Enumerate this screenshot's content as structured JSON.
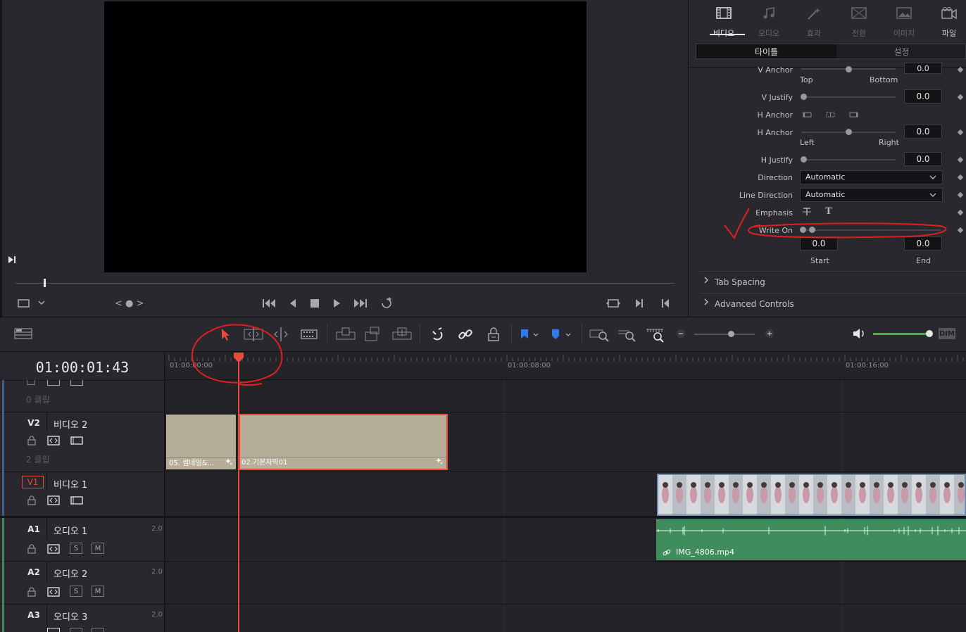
{
  "viewer": {
    "nav_label": "< ● >"
  },
  "inspector": {
    "tabs": [
      {
        "label": "비디오",
        "icon": "film-icon",
        "active": true
      },
      {
        "label": "오디오",
        "icon": "music-note-icon",
        "active": false
      },
      {
        "label": "효과",
        "icon": "magic-wand-icon",
        "active": false
      },
      {
        "label": "전환",
        "icon": "transition-icon",
        "active": false
      },
      {
        "label": "이미지",
        "icon": "image-icon",
        "active": false
      },
      {
        "label": "파일",
        "icon": "file-icon",
        "active": false
      }
    ],
    "subtabs": {
      "title": "타이틀",
      "settings": "설정"
    },
    "v_anchor": {
      "label": "V Anchor",
      "value": "0.0",
      "min_label": "Top",
      "max_label": "Bottom"
    },
    "v_justify": {
      "label": "V Justify",
      "value": "0.0"
    },
    "h_anchor_icons_label": "H Anchor",
    "h_anchor": {
      "label": "H Anchor",
      "value": "0.0",
      "min_label": "Left",
      "max_label": "Right"
    },
    "h_justify": {
      "label": "H Justify",
      "value": "0.0"
    },
    "direction": {
      "label": "Direction",
      "value": "Automatic"
    },
    "line_direction": {
      "label": "Line Direction",
      "value": "Automatic"
    },
    "emphasis": {
      "label": "Emphasis"
    },
    "write_on": {
      "label": "Write On",
      "start_value": "0.0",
      "end_value": "0.0",
      "start_label": "Start",
      "end_label": "End"
    },
    "sections": [
      "Tab Spacing",
      "Advanced Controls"
    ]
  },
  "toolbar": {
    "dim_label": "DIM",
    "accent_color": "#e64b3c",
    "flag_color": "#2f7ce6",
    "volume_color": "#3fb53f"
  },
  "timeline": {
    "timecode": "01:00:01:43",
    "ruler_labels": [
      "01:00:00:00",
      "01:00:08:00",
      "01:00:16:00"
    ],
    "tracks": [
      {
        "id": "",
        "name": "",
        "clips_label": "0 클립"
      },
      {
        "id": "V2",
        "name": "비디오 2",
        "clips_label": "2 클립"
      },
      {
        "id": "V1",
        "name": "비디오 1",
        "clips_label": ""
      },
      {
        "id": "A1",
        "name": "오디오 1",
        "channels": "2.0"
      },
      {
        "id": "A2",
        "name": "오디오 2",
        "channels": "2.0"
      },
      {
        "id": "A3",
        "name": "오디오 3",
        "channels": "2.0"
      }
    ],
    "solo_label": "S",
    "mute_label": "M",
    "clips": {
      "title_clip_1": "05. 썸네일&...",
      "title_clip_2": "02.기본자막01",
      "audio_clip": "IMG_4806.mp4"
    }
  }
}
